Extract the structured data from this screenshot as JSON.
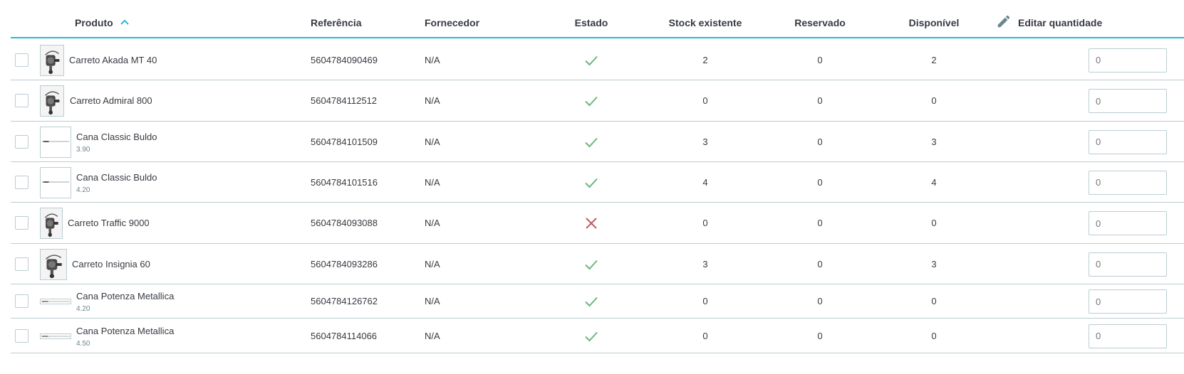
{
  "header": {
    "product": "Produto",
    "reference": "Referência",
    "supplier": "Fornecedor",
    "status": "Estado",
    "stock": "Stock existente",
    "reserved": "Reservado",
    "available": "Disponível",
    "edit_qty": "Editar quantidade",
    "sort_icon": "chevron-up-icon",
    "edit_icon": "pencil-icon"
  },
  "colors": {
    "accent": "#25b9d7",
    "check": "#70b580",
    "cross": "#c05c67",
    "border": "#bbcdd2",
    "text": "#363a41"
  },
  "rows": [
    {
      "name": "Carreto Akada MT 40",
      "combination": "",
      "reference": "5604784090469",
      "supplier": "N/A",
      "status": "enabled",
      "stock": "2",
      "reserved": "0",
      "available": "2",
      "qty_placeholder": "0"
    },
    {
      "name": "Carreto Admiral 800",
      "combination": "",
      "reference": "5604784112512",
      "supplier": "N/A",
      "status": "enabled",
      "stock": "0",
      "reserved": "0",
      "available": "0",
      "qty_placeholder": "0"
    },
    {
      "name": "Cana Classic Buldo",
      "combination": "3.90",
      "reference": "5604784101509",
      "supplier": "N/A",
      "status": "enabled",
      "stock": "3",
      "reserved": "0",
      "available": "3",
      "qty_placeholder": "0"
    },
    {
      "name": "Cana Classic Buldo",
      "combination": "4.20",
      "reference": "5604784101516",
      "supplier": "N/A",
      "status": "enabled",
      "stock": "4",
      "reserved": "0",
      "available": "4",
      "qty_placeholder": "0"
    },
    {
      "name": "Carreto Traffic 9000",
      "combination": "",
      "reference": "5604784093088",
      "supplier": "N/A",
      "status": "disabled",
      "stock": "0",
      "reserved": "0",
      "available": "0",
      "qty_placeholder": "0"
    },
    {
      "name": "Carreto Insignia 60",
      "combination": "",
      "reference": "5604784093286",
      "supplier": "N/A",
      "status": "enabled",
      "stock": "3",
      "reserved": "0",
      "available": "3",
      "qty_placeholder": "0"
    },
    {
      "name": "Cana Potenza Metallica",
      "combination": "4.20",
      "reference": "5604784126762",
      "supplier": "N/A",
      "status": "enabled",
      "stock": "0",
      "reserved": "0",
      "available": "0",
      "qty_placeholder": "0"
    },
    {
      "name": "Cana Potenza Metallica",
      "combination": "4.50",
      "reference": "5604784114066",
      "supplier": "N/A",
      "status": "enabled",
      "stock": "0",
      "reserved": "0",
      "available": "0",
      "qty_placeholder": "0"
    }
  ]
}
